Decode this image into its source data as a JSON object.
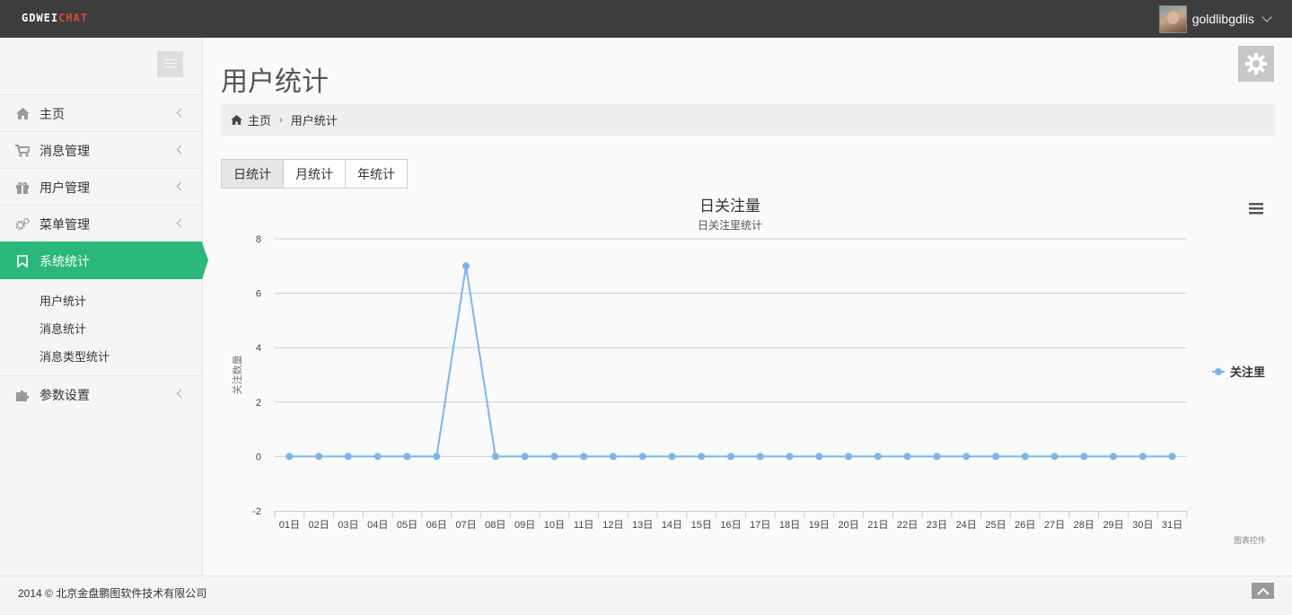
{
  "app": {
    "logo_part1": "GDWEI",
    "logo_part2": "CHAT",
    "brand_color": "#d84a38"
  },
  "user": {
    "name": "goldlibgdlis"
  },
  "sidebar": {
    "items": [
      {
        "label": "主页",
        "icon": "home-icon"
      },
      {
        "label": "消息管理",
        "icon": "cart-icon"
      },
      {
        "label": "用户管理",
        "icon": "gift-icon"
      },
      {
        "label": "菜单管理",
        "icon": "cogs-icon"
      },
      {
        "label": "系统统计",
        "icon": "bookmark-icon",
        "active": true
      },
      {
        "label": "参数设置",
        "icon": "puzzle-icon"
      }
    ],
    "subitems": [
      "用户统计",
      "消息统计",
      "消息类型统计"
    ],
    "active_color": "#2ab97a"
  },
  "page": {
    "title": "用户统计"
  },
  "breadcrumb": {
    "home": "主页",
    "current": "用户统计"
  },
  "tabs": [
    "日统计",
    "月统计",
    "年统计"
  ],
  "chart_data": {
    "type": "line",
    "title": "日关注量",
    "subtitle": "日关注里统计",
    "ylabel": "关注数量",
    "xlabel": "",
    "ylim": [
      -2,
      8
    ],
    "yticks": [
      -2,
      0,
      2,
      4,
      6,
      8
    ],
    "categories": [
      "01日",
      "02日",
      "03日",
      "04日",
      "05日",
      "06日",
      "07日",
      "08日",
      "09日",
      "10日",
      "11日",
      "12日",
      "13日",
      "14日",
      "15日",
      "16日",
      "17日",
      "18日",
      "19日",
      "20日",
      "21日",
      "22日",
      "23日",
      "24日",
      "25日",
      "26日",
      "27日",
      "28日",
      "29日",
      "30日",
      "31日"
    ],
    "series": [
      {
        "name": "关注里",
        "color": "#7cb5ec",
        "values": [
          0,
          0,
          0,
          0,
          0,
          0,
          7,
          0,
          0,
          0,
          0,
          0,
          0,
          0,
          0,
          0,
          0,
          0,
          0,
          0,
          0,
          0,
          0,
          0,
          0,
          0,
          0,
          0,
          0,
          0,
          0
        ]
      }
    ],
    "legend_position": "right",
    "grid": true,
    "credits": "图表控件"
  },
  "footer": {
    "copyright": "2014 © 北京金盘鹏图软件技术有限公司"
  }
}
